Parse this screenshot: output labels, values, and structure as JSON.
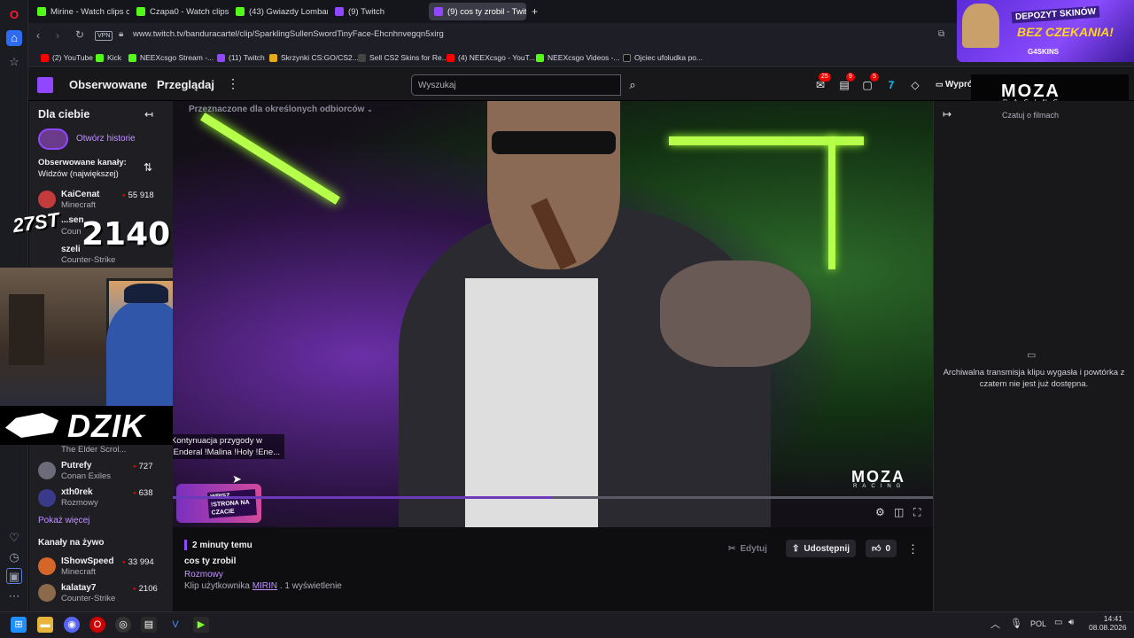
{
  "browser": {
    "tabs": [
      {
        "title": "Mirine - Watch clips on K",
        "favcolor": "#53fc18",
        "active": false
      },
      {
        "title": "Czapa0 - Watch clips on K",
        "favcolor": "#53fc18",
        "active": false
      },
      {
        "title": "(43) Gwiazdy Lombardu: C",
        "favcolor": "#53fc18",
        "active": false
      },
      {
        "title": "(9) Twitch",
        "favcolor": "#9146ff",
        "active": false
      },
      {
        "title": "(9) cos ty zrobil - Twit",
        "favcolor": "#9146ff",
        "active": true
      }
    ],
    "new_tab": "+",
    "vpn_label": "VPN",
    "url": "www.twitch.tv/banduracartel/clip/SparklingSullenSwordTinyFace-Ehcnhnvegqn5xirg",
    "bookmarks": [
      {
        "label": "(2) YouTube",
        "favcolor": "#ff0000"
      },
      {
        "label": "Kick",
        "favcolor": "#53fc18"
      },
      {
        "label": "NEEXcsgo Stream -...",
        "favcolor": "#53fc18"
      },
      {
        "label": "(11) Twitch",
        "favcolor": "#9146ff"
      },
      {
        "label": "Skrzynki CS:GO/CS2...",
        "favcolor": "#e6a91a"
      },
      {
        "label": "Sell CS2 Skins for Re...",
        "favcolor": "#444444"
      },
      {
        "label": "(4) NEEXcsgo - YouT...",
        "favcolor": "#ff0000"
      },
      {
        "label": "NEEXcsgo Videos -...",
        "favcolor": "#53fc18"
      },
      {
        "label": "Ojciec ufoludka po...",
        "favcolor": "#111111"
      }
    ]
  },
  "twitch_nav": {
    "followed": "Obserwowane",
    "browse": "Przeglądaj",
    "more": "⋮",
    "search_placeholder": "Wyszukaj",
    "badges": [
      "25",
      "9",
      "5"
    ],
    "prime": "Wyprób"
  },
  "sidebar": {
    "title": "Dla ciebie",
    "collapse": "↤",
    "stories": "Otwórz historie",
    "followed_heading": "Obserwowane kanały:",
    "followed_sort": "Widzów (największej)",
    "channels_top": [
      {
        "name": "KaiCenat",
        "game": "Minecraft",
        "viewers": "55 918",
        "color": "#c43b3b"
      }
    ],
    "partial_1": "...sen",
    "partial_2": "Coun",
    "partial_3": "szeli",
    "partial_4": "Counter-Strike",
    "partial_game": "The Elder Scrol...",
    "channels_bottom": [
      {
        "name": "Putrefy",
        "game": "Conan Exiles",
        "viewers": "727",
        "color": "#6b6b7a"
      },
      {
        "name": "xth0rek",
        "game": "Rozmowy",
        "viewers": "638",
        "color": "#3a3a8a"
      }
    ],
    "show_more": "Pokaż więcej",
    "live_heading": "Kanały na żywo",
    "live_channels": [
      {
        "name": "IShowSpeed",
        "game": "Minecraft",
        "viewers": "33 994",
        "color": "#d4662a"
      },
      {
        "name": "kalatay7",
        "game": "Counter-Strike",
        "viewers": "2106",
        "color": "#8a6a4a"
      }
    ]
  },
  "video": {
    "audience_notice": "Przeznaczone dla określonych odbiorców",
    "overlay_number": "2140",
    "overlay_tag": "27ST",
    "overlay_brand": "DZIK",
    "overlay_chat_line1": "Kontynuacja przygody w",
    "overlay_chat_line2": "!Enderal !Malina !Holy !Ene...",
    "moza_brand": "MOZA",
    "moza_sub": "RACING",
    "sticker": "WPISZ !STRONA NA CZACIE"
  },
  "clip": {
    "time_ago": "2 minuty temu",
    "title": "cos ty zrobil",
    "category": "Rozmowy",
    "byline_prefix": "Klip użytkownika",
    "author": "MIRIN",
    "views": ". 1 wyświetlenie",
    "edit": "Edytuj",
    "share": "Udostępnij",
    "likes": "0",
    "more": "⋮"
  },
  "chat": {
    "expand": "↦",
    "header": "Czatuj o filmach",
    "expired_line1": "Archiwalna transmisja klipu wygasła i powtórka z",
    "expired_line2": "czatem nie jest już dostępna."
  },
  "ad": {
    "line1": "DEPOZYT SKINÓW",
    "line2": "BEZ CZEKANIA!",
    "brand": "SKINS"
  },
  "taskbar": {
    "chevron": "︿",
    "lang": "POL",
    "time": "14:41",
    "date": "08.08.2026"
  }
}
